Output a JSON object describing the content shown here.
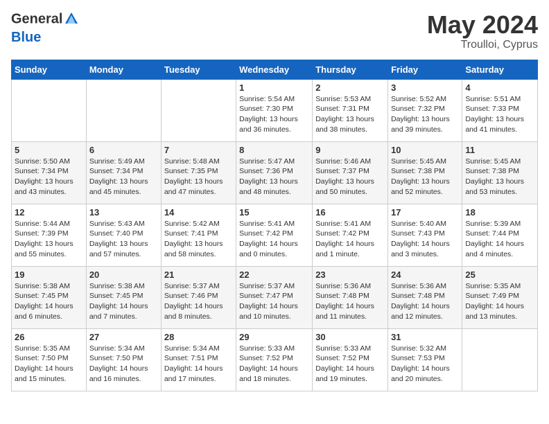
{
  "logo": {
    "general": "General",
    "blue": "Blue"
  },
  "title": "May 2024",
  "location": "Troulloi, Cyprus",
  "weekdays": [
    "Sunday",
    "Monday",
    "Tuesday",
    "Wednesday",
    "Thursday",
    "Friday",
    "Saturday"
  ],
  "weeks": [
    [
      {
        "day": "",
        "sunrise": "",
        "sunset": "",
        "daylight": ""
      },
      {
        "day": "",
        "sunrise": "",
        "sunset": "",
        "daylight": ""
      },
      {
        "day": "",
        "sunrise": "",
        "sunset": "",
        "daylight": ""
      },
      {
        "day": "1",
        "sunrise": "Sunrise: 5:54 AM",
        "sunset": "Sunset: 7:30 PM",
        "daylight": "Daylight: 13 hours and 36 minutes."
      },
      {
        "day": "2",
        "sunrise": "Sunrise: 5:53 AM",
        "sunset": "Sunset: 7:31 PM",
        "daylight": "Daylight: 13 hours and 38 minutes."
      },
      {
        "day": "3",
        "sunrise": "Sunrise: 5:52 AM",
        "sunset": "Sunset: 7:32 PM",
        "daylight": "Daylight: 13 hours and 39 minutes."
      },
      {
        "day": "4",
        "sunrise": "Sunrise: 5:51 AM",
        "sunset": "Sunset: 7:33 PM",
        "daylight": "Daylight: 13 hours and 41 minutes."
      }
    ],
    [
      {
        "day": "5",
        "sunrise": "Sunrise: 5:50 AM",
        "sunset": "Sunset: 7:34 PM",
        "daylight": "Daylight: 13 hours and 43 minutes."
      },
      {
        "day": "6",
        "sunrise": "Sunrise: 5:49 AM",
        "sunset": "Sunset: 7:34 PM",
        "daylight": "Daylight: 13 hours and 45 minutes."
      },
      {
        "day": "7",
        "sunrise": "Sunrise: 5:48 AM",
        "sunset": "Sunset: 7:35 PM",
        "daylight": "Daylight: 13 hours and 47 minutes."
      },
      {
        "day": "8",
        "sunrise": "Sunrise: 5:47 AM",
        "sunset": "Sunset: 7:36 PM",
        "daylight": "Daylight: 13 hours and 48 minutes."
      },
      {
        "day": "9",
        "sunrise": "Sunrise: 5:46 AM",
        "sunset": "Sunset: 7:37 PM",
        "daylight": "Daylight: 13 hours and 50 minutes."
      },
      {
        "day": "10",
        "sunrise": "Sunrise: 5:45 AM",
        "sunset": "Sunset: 7:38 PM",
        "daylight": "Daylight: 13 hours and 52 minutes."
      },
      {
        "day": "11",
        "sunrise": "Sunrise: 5:45 AM",
        "sunset": "Sunset: 7:38 PM",
        "daylight": "Daylight: 13 hours and 53 minutes."
      }
    ],
    [
      {
        "day": "12",
        "sunrise": "Sunrise: 5:44 AM",
        "sunset": "Sunset: 7:39 PM",
        "daylight": "Daylight: 13 hours and 55 minutes."
      },
      {
        "day": "13",
        "sunrise": "Sunrise: 5:43 AM",
        "sunset": "Sunset: 7:40 PM",
        "daylight": "Daylight: 13 hours and 57 minutes."
      },
      {
        "day": "14",
        "sunrise": "Sunrise: 5:42 AM",
        "sunset": "Sunset: 7:41 PM",
        "daylight": "Daylight: 13 hours and 58 minutes."
      },
      {
        "day": "15",
        "sunrise": "Sunrise: 5:41 AM",
        "sunset": "Sunset: 7:42 PM",
        "daylight": "Daylight: 14 hours and 0 minutes."
      },
      {
        "day": "16",
        "sunrise": "Sunrise: 5:41 AM",
        "sunset": "Sunset: 7:42 PM",
        "daylight": "Daylight: 14 hours and 1 minute."
      },
      {
        "day": "17",
        "sunrise": "Sunrise: 5:40 AM",
        "sunset": "Sunset: 7:43 PM",
        "daylight": "Daylight: 14 hours and 3 minutes."
      },
      {
        "day": "18",
        "sunrise": "Sunrise: 5:39 AM",
        "sunset": "Sunset: 7:44 PM",
        "daylight": "Daylight: 14 hours and 4 minutes."
      }
    ],
    [
      {
        "day": "19",
        "sunrise": "Sunrise: 5:38 AM",
        "sunset": "Sunset: 7:45 PM",
        "daylight": "Daylight: 14 hours and 6 minutes."
      },
      {
        "day": "20",
        "sunrise": "Sunrise: 5:38 AM",
        "sunset": "Sunset: 7:45 PM",
        "daylight": "Daylight: 14 hours and 7 minutes."
      },
      {
        "day": "21",
        "sunrise": "Sunrise: 5:37 AM",
        "sunset": "Sunset: 7:46 PM",
        "daylight": "Daylight: 14 hours and 8 minutes."
      },
      {
        "day": "22",
        "sunrise": "Sunrise: 5:37 AM",
        "sunset": "Sunset: 7:47 PM",
        "daylight": "Daylight: 14 hours and 10 minutes."
      },
      {
        "day": "23",
        "sunrise": "Sunrise: 5:36 AM",
        "sunset": "Sunset: 7:48 PM",
        "daylight": "Daylight: 14 hours and 11 minutes."
      },
      {
        "day": "24",
        "sunrise": "Sunrise: 5:36 AM",
        "sunset": "Sunset: 7:48 PM",
        "daylight": "Daylight: 14 hours and 12 minutes."
      },
      {
        "day": "25",
        "sunrise": "Sunrise: 5:35 AM",
        "sunset": "Sunset: 7:49 PM",
        "daylight": "Daylight: 14 hours and 13 minutes."
      }
    ],
    [
      {
        "day": "26",
        "sunrise": "Sunrise: 5:35 AM",
        "sunset": "Sunset: 7:50 PM",
        "daylight": "Daylight: 14 hours and 15 minutes."
      },
      {
        "day": "27",
        "sunrise": "Sunrise: 5:34 AM",
        "sunset": "Sunset: 7:50 PM",
        "daylight": "Daylight: 14 hours and 16 minutes."
      },
      {
        "day": "28",
        "sunrise": "Sunrise: 5:34 AM",
        "sunset": "Sunset: 7:51 PM",
        "daylight": "Daylight: 14 hours and 17 minutes."
      },
      {
        "day": "29",
        "sunrise": "Sunrise: 5:33 AM",
        "sunset": "Sunset: 7:52 PM",
        "daylight": "Daylight: 14 hours and 18 minutes."
      },
      {
        "day": "30",
        "sunrise": "Sunrise: 5:33 AM",
        "sunset": "Sunset: 7:52 PM",
        "daylight": "Daylight: 14 hours and 19 minutes."
      },
      {
        "day": "31",
        "sunrise": "Sunrise: 5:32 AM",
        "sunset": "Sunset: 7:53 PM",
        "daylight": "Daylight: 14 hours and 20 minutes."
      },
      {
        "day": "",
        "sunrise": "",
        "sunset": "",
        "daylight": ""
      }
    ]
  ]
}
